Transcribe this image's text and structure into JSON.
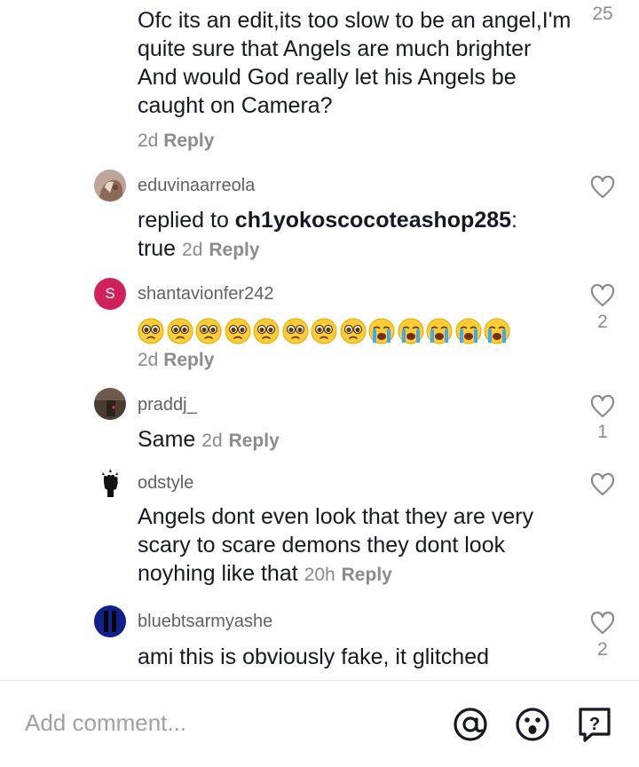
{
  "reply_label": "Reply",
  "comments": [
    {
      "text": "Ofc its an edit,its too slow to be an angel,I'm quite sure that Angels are much brighter And would God really let his Angels be caught on Camera?",
      "time": "2d",
      "likes": "25"
    },
    {
      "username": "eduvinaarreola",
      "reply_prefix": "replied to ",
      "mention": "ch1yokoscocoteashop285",
      "reply_suffix": ":",
      "text": "true",
      "time": "2d",
      "likes": ""
    },
    {
      "username": "shantavionfer242",
      "avatar_letter": "S",
      "avatar_color": "#d0215d",
      "emojis": [
        "pleading-face",
        "pleading-face",
        "pleading-face",
        "pleading-face",
        "pleading-face",
        "pleading-face",
        "pleading-face",
        "pleading-face",
        "crying-face",
        "crying-face",
        "crying-face",
        "crying-face",
        "crying-face"
      ],
      "time": "2d",
      "likes": "2"
    },
    {
      "username": "praddj_",
      "text": "Same",
      "time": "2d",
      "likes": "1"
    },
    {
      "username": "odstyle",
      "text": "Angels dont even look that they are very scary to scare demons they dont look noyhing like that",
      "time": "20h",
      "likes": ""
    },
    {
      "username": "bluebtsarmyashe",
      "text": "ami this is obviously fake, it glitched",
      "likes": "2"
    }
  ],
  "footer": {
    "placeholder": "Add comment...",
    "icons": [
      "at-sign-icon",
      "emoji-icon",
      "question-box-icon"
    ]
  }
}
